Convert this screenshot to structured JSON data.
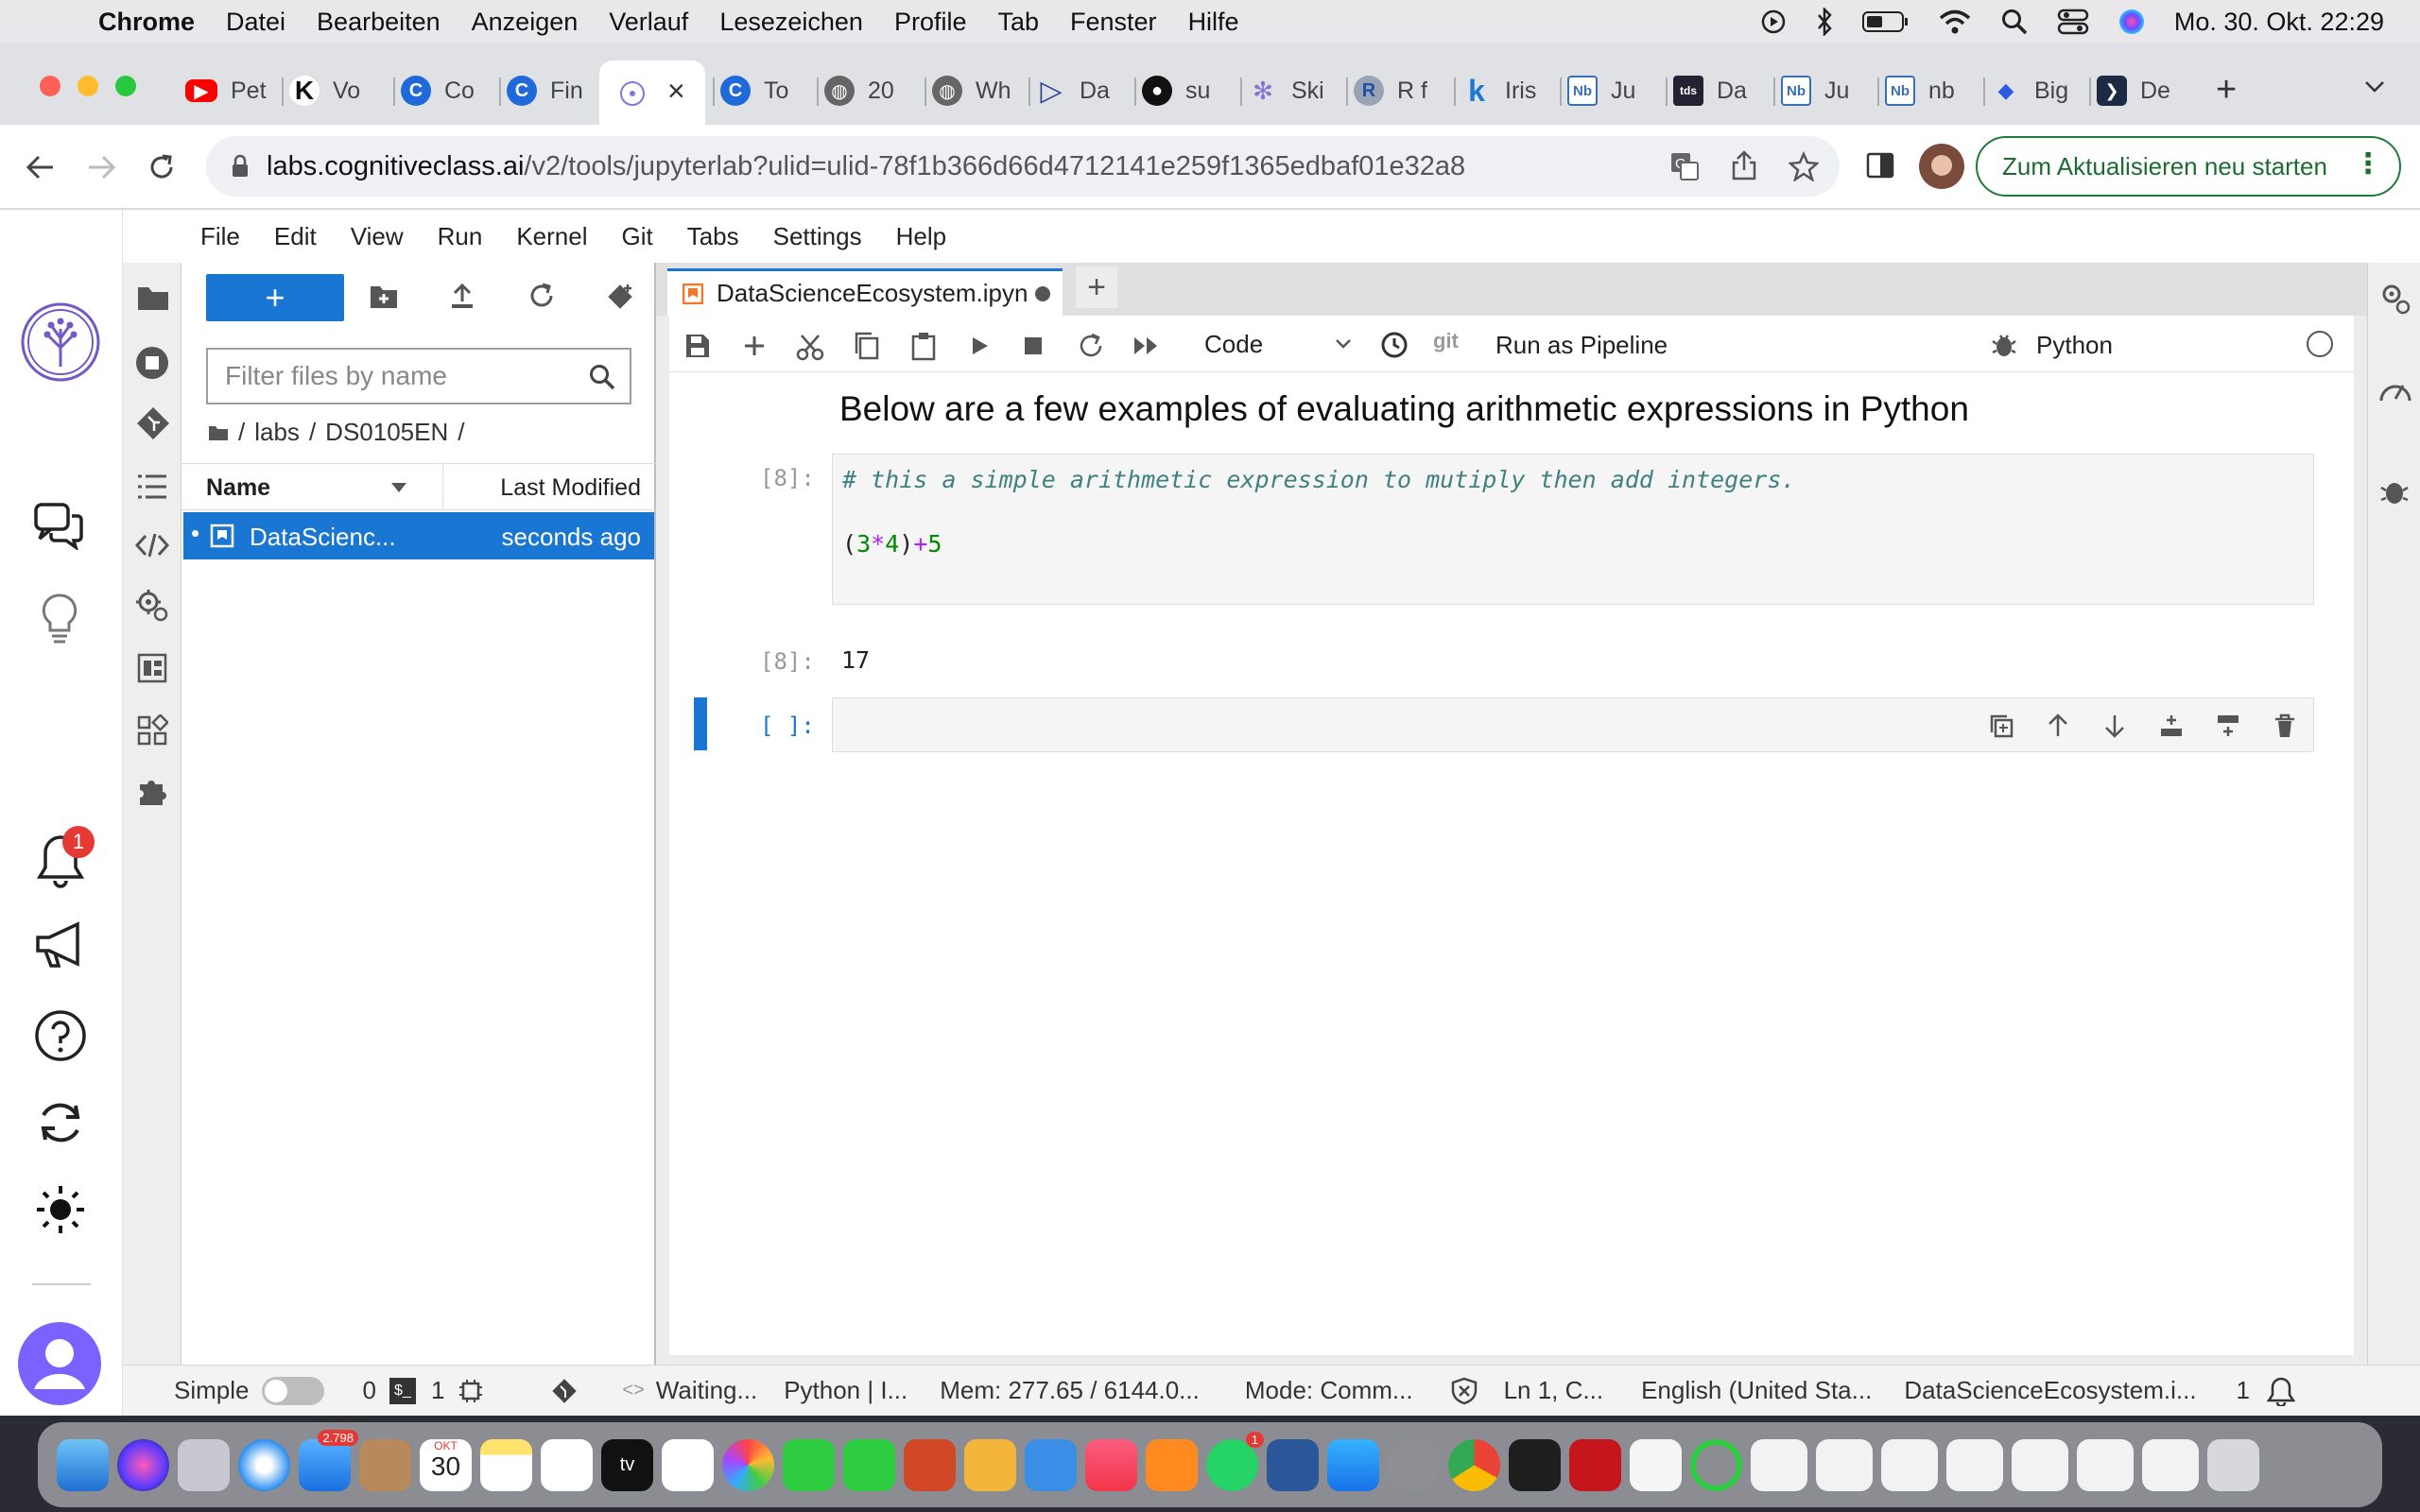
{
  "menubar": {
    "app": "Chrome",
    "items": [
      "Datei",
      "Bearbeiten",
      "Anzeigen",
      "Verlauf",
      "Lesezeichen",
      "Profile",
      "Tab",
      "Fenster",
      "Hilfe"
    ],
    "datetime": "Mo. 30. Okt.  22:29"
  },
  "chrome": {
    "tabs": [
      "Pet",
      "Vo",
      "Co",
      "Fin",
      "",
      "To",
      "20",
      "Wh",
      "Da",
      "su",
      "Ski",
      "R f",
      "Iris",
      "Ju",
      "Da",
      "Ju",
      "nb",
      "Big",
      "De"
    ],
    "new_tab": "+",
    "url_host": "labs.cognitiveclass.ai",
    "url_path": "/v2/tools/jupyterlab?ulid=ulid-78f1b366d66d4712141e259f1365edbaf01e32a8",
    "update_button": "Zum Aktualisieren neu starten"
  },
  "jupyter": {
    "menu": [
      "File",
      "Edit",
      "View",
      "Run",
      "Kernel",
      "Git",
      "Tabs",
      "Settings",
      "Help"
    ],
    "filebrowser": {
      "new_label": "+",
      "filter_placeholder": "Filter files by name",
      "breadcrumb": [
        "labs",
        "DS0105EN"
      ],
      "col_name": "Name",
      "col_modified": "Last Modified",
      "files": [
        {
          "name": "DataScienc...",
          "modified": "seconds ago"
        }
      ]
    },
    "notebook": {
      "tab_title": "DataScienceEcosystem.ipyn",
      "cell_type": "Code",
      "git_label": "git",
      "pipeline_label": "Run as Pipeline",
      "kernel": "Python",
      "heading": "Below are a few examples of evaluating arithmetic expressions in Python",
      "cell1_prompt": "[8]:",
      "cell1_comment": "# this a simple arithmetic expression to mutiply then add integers.",
      "cell1_code": {
        "open": "(",
        "a": "3",
        "op1": "*",
        "b": "4",
        "close": ")",
        "op2": "+",
        "c": "5"
      },
      "out1_prompt": "[8]:",
      "out1_value": "17",
      "cell2_prompt": "[ ]:"
    },
    "status": {
      "simple": "Simple",
      "count0": "0",
      "count1": "1",
      "waiting": "Waiting...",
      "kernel": "Python | I...",
      "mem": "Mem: 277.65 / 6144.0...",
      "mode": "Mode: Comm...",
      "position": "Ln 1, C...",
      "language": "English (United Sta...",
      "filename": "DataScienceEcosystem.i...",
      "count_right": "1"
    },
    "notification_badge": "1"
  },
  "dock": {
    "mail_badge": "2.798",
    "calendar_month": "OKT",
    "calendar_day": "30",
    "tv_label": "tv",
    "whatsapp_badge": "1"
  }
}
